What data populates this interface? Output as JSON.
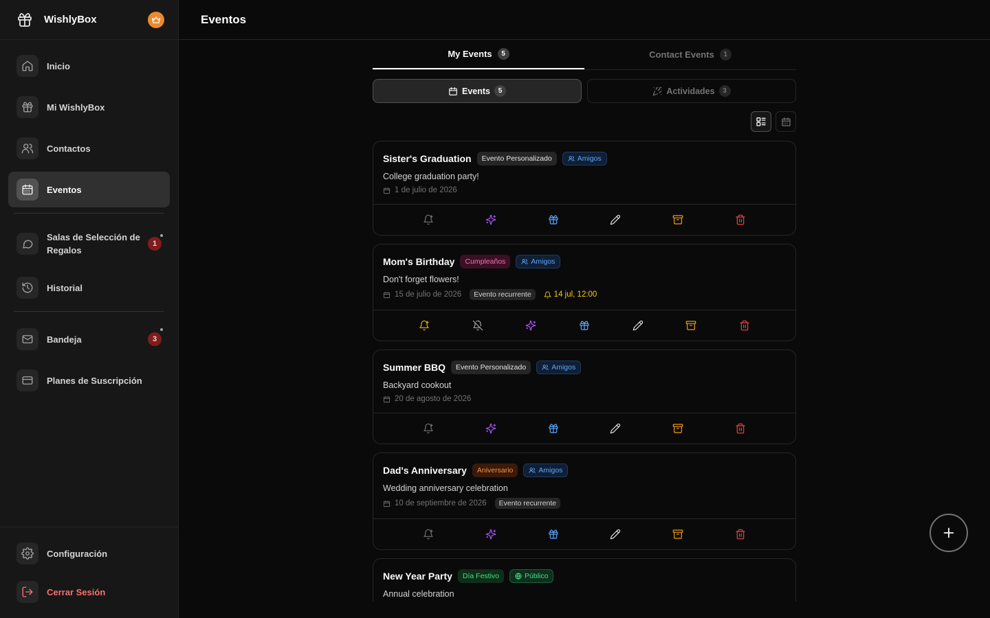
{
  "app": {
    "name": "WishlyBox"
  },
  "page": {
    "title": "Eventos"
  },
  "sidebar": {
    "items": [
      {
        "label": "Inicio",
        "icon": "home-icon"
      },
      {
        "label": "Mi WishlyBox",
        "icon": "gift-icon"
      },
      {
        "label": "Contactos",
        "icon": "users-icon"
      },
      {
        "label": "Eventos",
        "icon": "calendar-icon"
      },
      {
        "label": "Salas de Selección de Regalos",
        "icon": "chat-icon",
        "badge": "1"
      },
      {
        "label": "Historial",
        "icon": "history-icon"
      },
      {
        "label": "Bandeja",
        "icon": "mail-icon",
        "badge": "3"
      },
      {
        "label": "Planes de Suscripción",
        "icon": "credit-card-icon"
      }
    ],
    "bottom": [
      {
        "label": "Configuración",
        "icon": "gear-icon"
      },
      {
        "label": "Cerrar Sesión",
        "icon": "logout-icon"
      }
    ]
  },
  "tabs": [
    {
      "label": "My Events",
      "count": "5"
    },
    {
      "label": "Contact Events",
      "count": "1"
    }
  ],
  "subtabs": [
    {
      "label": "Events",
      "count": "5"
    },
    {
      "label": "Actividades",
      "count": "3"
    }
  ],
  "events": [
    {
      "title": "Sister's Graduation",
      "category": "Evento Personalizado",
      "audience": "Amigos",
      "description": "College graduation party!",
      "date": "1 de julio de 2026"
    },
    {
      "title": "Mom's Birthday",
      "category": "Cumpleaños",
      "audience": "Amigos",
      "description": "Don't forget flowers!",
      "date": "15 de julio de 2026",
      "recurring": "Evento recurrente",
      "reminder": "14 jul, 12:00"
    },
    {
      "title": "Summer BBQ",
      "category": "Evento Personalizado",
      "audience": "Amigos",
      "description": "Backyard cookout",
      "date": "20 de agosto de 2026"
    },
    {
      "title": "Dad's Anniversary",
      "category": "Aniversario",
      "audience": "Amigos",
      "description": "Wedding anniversary celebration",
      "date": "10 de septiembre de 2026",
      "recurring": "Evento recurrente"
    },
    {
      "title": "New Year Party",
      "category": "Día Festivo",
      "audience": "Público",
      "description": "Annual celebration"
    }
  ],
  "colors": {
    "accent": "#fafafa",
    "danger": "#ef4444",
    "crown": "#ea8a2e"
  }
}
